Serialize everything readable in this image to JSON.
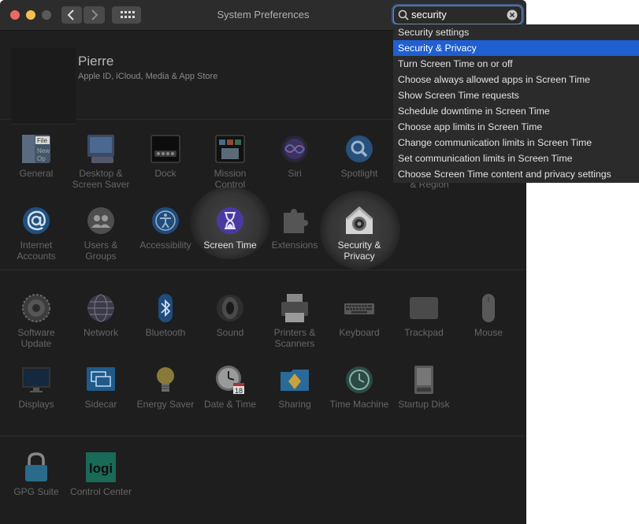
{
  "window": {
    "title": "System Preferences"
  },
  "search": {
    "value": "security"
  },
  "user": {
    "name": "Pierre",
    "subtitle": "Apple ID, iCloud, Media & App Store"
  },
  "panes": {
    "general": "General",
    "desktop": "Desktop & Screen Saver",
    "dock": "Dock",
    "mission": "Mission Control",
    "siri": "Siri",
    "spotlight": "Spotlight",
    "language_tail": "& Region",
    "internet": "Internet Accounts",
    "users": "Users & Groups",
    "accessibility": "Accessibility",
    "screentime": "Screen Time",
    "extensions": "Extensions",
    "security": "Security & Privacy",
    "software": "Software Update",
    "network": "Network",
    "bluetooth": "Bluetooth",
    "sound": "Sound",
    "printers": "Printers & Scanners",
    "keyboard": "Keyboard",
    "trackpad": "Trackpad",
    "mouse": "Mouse",
    "displays": "Displays",
    "sidecar": "Sidecar",
    "energy": "Energy Saver",
    "datetime": "Date & Time",
    "sharing": "Sharing",
    "timemachine": "Time Machine",
    "startup": "Startup Disk",
    "gpg": "GPG Suite",
    "control": "Control Center"
  },
  "icon_text": {
    "general_file": "File",
    "general_new": "New",
    "general_open": "Op",
    "date_day": "18",
    "logi": "logi"
  },
  "suggestions": [
    "Security settings",
    "Security & Privacy",
    "Turn Screen Time on or off",
    "Choose always allowed apps in Screen Time",
    "Show Screen Time requests",
    "Schedule downtime in Screen Time",
    "Choose app limits in Screen Time",
    "Change communication limits in Screen Time",
    "Set communication limits in Screen Time",
    "Choose Screen Time content and privacy settings"
  ],
  "selected_suggestion": "Security & Privacy",
  "colors": {
    "accent": "#1f5fd0",
    "window_bg": "#1e1e1e",
    "dropdown_bg": "#2b2b2b",
    "dim_label": "#666666"
  }
}
